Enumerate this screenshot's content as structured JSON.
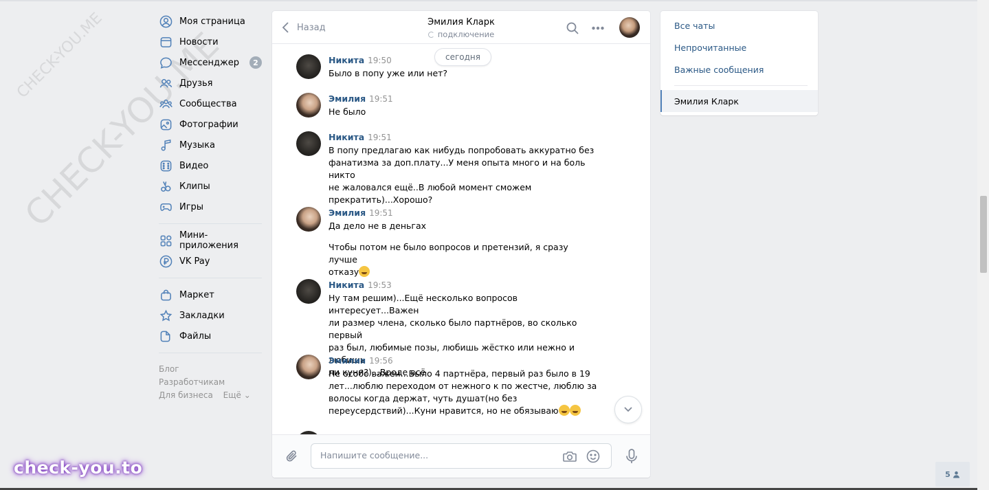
{
  "watermarks": {
    "small": "CHECK-YOU.ME",
    "large": "CHECK-YOU.ME",
    "logo": "check-you.to"
  },
  "leftnav": {
    "items": [
      {
        "label": "Моя страница",
        "icon": "user-circle-icon"
      },
      {
        "label": "Новости",
        "icon": "news-icon"
      },
      {
        "label": "Мессенджер",
        "icon": "message-icon",
        "badge": "2"
      },
      {
        "label": "Друзья",
        "icon": "friends-icon"
      },
      {
        "label": "Сообщества",
        "icon": "communities-icon"
      },
      {
        "label": "Фотографии",
        "icon": "photo-icon"
      },
      {
        "label": "Музыка",
        "icon": "music-icon"
      },
      {
        "label": "Видео",
        "icon": "video-icon"
      },
      {
        "label": "Клипы",
        "icon": "clips-icon"
      },
      {
        "label": "Игры",
        "icon": "gamepad-icon"
      }
    ],
    "items2": [
      {
        "label": "Мини-приложения",
        "icon": "apps-icon"
      },
      {
        "label": "VK Pay",
        "icon": "vkpay-icon"
      }
    ],
    "items3": [
      {
        "label": "Маркет",
        "icon": "bag-icon"
      },
      {
        "label": "Закладки",
        "icon": "star-icon"
      },
      {
        "label": "Файлы",
        "icon": "file-icon"
      }
    ],
    "footer": {
      "blog": "Блог",
      "developers": "Разработчикам",
      "business": "Для бизнеса",
      "more": "Ещё ⌄"
    }
  },
  "chat": {
    "back_label": "Назад",
    "peer_name": "Эмилия Кларк",
    "peer_status": "подключение",
    "date_pill": "сегодня",
    "messages": [
      {
        "author": "Никита",
        "time": "19:50",
        "avatar": "nikita",
        "lines": [
          "Было в попу уже или нет?"
        ]
      },
      {
        "author": "Эмилия",
        "time": "19:51",
        "avatar": "emilia",
        "lines": [
          "Не было"
        ]
      },
      {
        "author": "Никита",
        "time": "19:51",
        "avatar": "nikita",
        "lines": [
          "В попу предлагаю как нибудь попробовать аккуратно без\nфанатизма за доп.плату...У меня опыта много и на боль никто\nне жаловался ещё..В любой момент сможем\nпрекратить)...Хорошо?"
        ]
      },
      {
        "author": "Эмилия",
        "time": "19:51",
        "avatar": "emilia",
        "lines": [
          "Да дело не в деньгах",
          "Чтобы потом не было вопросов и претензий, я сразу лучше\nотказу"
        ]
      },
      {
        "author": "Никита",
        "time": "19:53",
        "avatar": "nikita",
        "lines": [
          "Ну там решим)...Ещё несколько вопросов интересует...Важен\nли размер члена, сколько было партнёров, во сколько первый\nраз был, любимые позы, любишь жёстко или нежно и любишь\nли куни?)...Вроде всё"
        ]
      },
      {
        "author": "Эмилия",
        "time": "19:56",
        "avatar": "emilia",
        "lines": [
          "Не особо важен...Было 4 партнёра, первый раз было в 19\nлет...люблю переходом от нежного к по жестче, люблю за\nволосы когда держат, чуть душат(но без\nпереусердствий)...Куни нравится, но не обязываю"
        ]
      }
    ],
    "composer_placeholder": "Напишите сообщение..."
  },
  "filters": {
    "all": "Все чаты",
    "unread": "Непрочитанные",
    "important": "Важные сообщения",
    "active_chat": "Эмилия Кларк"
  },
  "online": {
    "count": "5"
  },
  "colors": {
    "accent": "#5181b8",
    "link": "#2a5885",
    "background": "#edeef0"
  }
}
